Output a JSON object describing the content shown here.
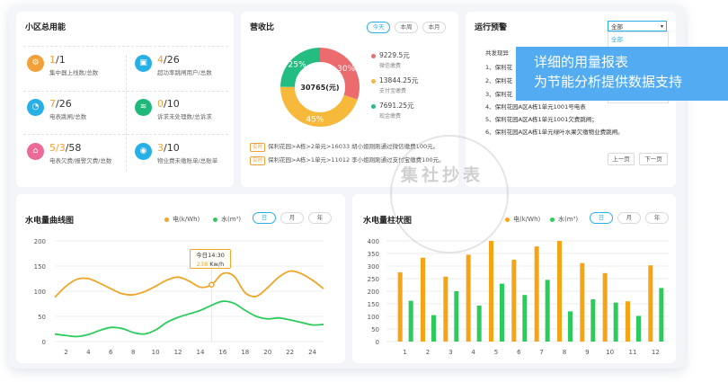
{
  "energy": {
    "title": "小区总用能",
    "stats": [
      {
        "icon": "meter-icon",
        "color": "#f2a13a",
        "value_a": "1",
        "value_b": "/1",
        "label": "集中器上线数/总数"
      },
      {
        "icon": "card-icon",
        "color": "#27b0e6",
        "value_a": "4",
        "value_b": "/26",
        "label": "超功率跳闸用户/总数"
      },
      {
        "icon": "trip-icon",
        "color": "#27b0e6",
        "value_a": "7",
        "value_b": "/26",
        "label": "电表跳闸/总数"
      },
      {
        "icon": "layers-icon",
        "color": "#20b87a",
        "value_a": "0",
        "value_b": "/10",
        "label": "诉求未处理数/总诉求"
      },
      {
        "icon": "house-icon",
        "color": "#ea6b98",
        "value_a": "5/3",
        "value_b": "/58",
        "label": "电表欠费/报警欠费/总数"
      },
      {
        "icon": "droplet-icon",
        "color": "#27b0e6",
        "value_a": "3",
        "value_b": "/10",
        "label": "物业费未缴账单/总账单"
      }
    ]
  },
  "revenue": {
    "title": "营收比",
    "tabs": [
      "今天",
      "本周",
      "本月"
    ],
    "active_tab": "今天",
    "center_value": "30765(元)",
    "slices": [
      {
        "pct": 30,
        "label": "30%",
        "color": "#ec6b6f"
      },
      {
        "pct": 45,
        "label": "45%",
        "color": "#f6b93b"
      },
      {
        "pct": 25,
        "label": "25%",
        "color": "#23bd82"
      }
    ],
    "legend": [
      {
        "value": "9229.5元",
        "name": "微信缴费",
        "color": "#ec6b6f"
      },
      {
        "value": "13844.25元",
        "name": "支付宝缴费",
        "color": "#f6b93b"
      },
      {
        "value": "7691.25元",
        "name": "现金缴费",
        "color": "#23bd82"
      }
    ],
    "realtime": [
      {
        "tag": "实时",
        "text": "保利花园>A栋>2单元>16033 胡小姐刚刚通过微信缴费100元。"
      },
      {
        "tag": "实时",
        "text": "保利花园>A栋>1单元>11012 李小姐刚刚通过支付宝缴费100元。"
      }
    ]
  },
  "alerts": {
    "title": "运行预警",
    "select_value": "全部",
    "select_option": "全部",
    "lines": [
      "共发现异",
      "1、保利花",
      "2、保利花",
      "3、保利花",
      "4、保利花园A区A栋1单元1001号电表",
      "5、保利花园A区A栋1单元1001欠费跳闸；",
      "6、保利花园A区A栋1单元绿叶水果欠缴物业费跳闸。"
    ],
    "prev": "上一页",
    "next": "下一页"
  },
  "banner": {
    "line1": "详细的用量报表",
    "line2": "为节能分析提供数据支持"
  },
  "watermark": {
    "text": "集社抄表"
  },
  "line_panel": {
    "title": "水电量曲线图",
    "legend_elec": "电(k/Wh)",
    "legend_water": "水(m³)",
    "tabs": [
      "日",
      "月",
      "年"
    ],
    "active_tab": "日",
    "tooltip_time": "今日14:30",
    "tooltip_value": "238",
    "tooltip_unit": "Kw/h"
  },
  "bar_panel": {
    "title": "水电量柱状图",
    "legend_elec": "电(k/Wh)",
    "legend_water": "水(m³)",
    "tabs": [
      "日",
      "月",
      "年"
    ],
    "active_tab": "日"
  },
  "chart_data": [
    {
      "type": "line",
      "title": "水电量曲线图",
      "x": [
        1,
        2,
        3,
        4,
        5,
        6,
        7,
        8,
        9,
        10,
        11,
        12,
        13,
        14,
        15,
        16,
        17,
        18,
        19,
        20,
        21,
        22,
        23,
        24,
        25
      ],
      "xticks": [
        2,
        4,
        6,
        8,
        10,
        12,
        14,
        16,
        18,
        20,
        22,
        24
      ],
      "ylim": [
        0,
        200
      ],
      "yticks": [
        0,
        50,
        100,
        150,
        200
      ],
      "series": [
        {
          "name": "电(k/Wh)",
          "color": "#f0a428",
          "values": [
            88,
            110,
            124,
            125,
            116,
            105,
            95,
            93,
            99,
            110,
            122,
            128,
            120,
            108,
            113,
            135,
            130,
            97,
            90,
            107,
            128,
            140,
            135,
            122,
            105
          ]
        },
        {
          "name": "水(m³)",
          "color": "#2bcc5c",
          "values": [
            15,
            12,
            10,
            14,
            22,
            28,
            26,
            18,
            15,
            23,
            38,
            48,
            55,
            62,
            72,
            80,
            76,
            62,
            50,
            45,
            47,
            43,
            38,
            33,
            34
          ]
        }
      ]
    },
    {
      "type": "bar",
      "title": "水电量柱状图",
      "categories": [
        "1",
        "2",
        "3",
        "4",
        "5",
        "6",
        "7",
        "8",
        "9",
        "10",
        "11",
        "12"
      ],
      "ylim": [
        0,
        400
      ],
      "yticks": [
        0,
        50,
        100,
        150,
        200,
        250,
        300,
        350,
        400
      ],
      "series": [
        {
          "name": "电(k/Wh)",
          "color": "#f5a416",
          "values": [
            275,
            333,
            258,
            345,
            400,
            325,
            378,
            400,
            312,
            272,
            160,
            303
          ]
        },
        {
          "name": "水(m³)",
          "color": "#2bcc5c",
          "values": [
            162,
            105,
            200,
            143,
            230,
            185,
            245,
            120,
            168,
            155,
            102,
            213
          ]
        }
      ]
    }
  ]
}
